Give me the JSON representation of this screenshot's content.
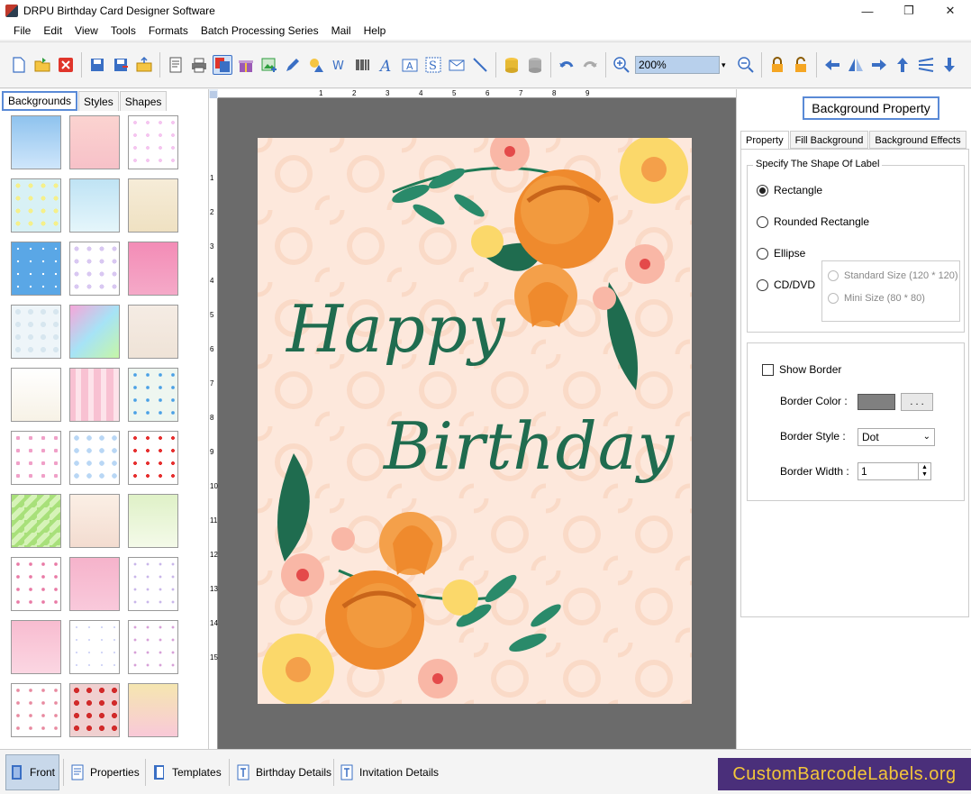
{
  "window": {
    "title": "DRPU Birthday Card Designer Software",
    "min_glyph": "—",
    "max_glyph": "❐",
    "close_glyph": "✕"
  },
  "menu": [
    "File",
    "Edit",
    "View",
    "Tools",
    "Formats",
    "Batch Processing Series",
    "Mail",
    "Help"
  ],
  "toolbar": {
    "zoom_value": "200%",
    "zoom_drop": "▾"
  },
  "left_panel": {
    "tabs": [
      "Backgrounds",
      "Styles",
      "Shapes"
    ]
  },
  "ruler": {
    "h_ticks": [
      "1",
      "2",
      "3",
      "4",
      "5",
      "6",
      "7",
      "8",
      "9"
    ],
    "v_ticks": [
      "1",
      "2",
      "3",
      "4",
      "5",
      "6",
      "7",
      "8",
      "9",
      "10",
      "11",
      "12",
      "13",
      "14",
      "15"
    ]
  },
  "card": {
    "line1": "Happy",
    "line2": "Birthday"
  },
  "right_panel": {
    "header": "Background Property",
    "tabs": [
      "Property",
      "Fill Background",
      "Background Effects"
    ],
    "shape_group_label": "Specify The Shape Of Label",
    "shapes": [
      "Rectangle",
      "Rounded Rectangle",
      "Ellipse",
      "CD/DVD"
    ],
    "selected_shape": "Rectangle",
    "cd_options": [
      "Standard Size (120 * 120)",
      "Mini Size (80 * 80)"
    ],
    "show_border": "Show Border",
    "border_color_label": "Border Color :",
    "border_color_btn": ". . .",
    "border_style_label": "Border Style :",
    "border_style_value": "Dot",
    "border_width_label": "Border Width :",
    "border_width_value": "1"
  },
  "bottom_tabs": [
    "Front",
    "Properties",
    "Templates",
    "Birthday Details",
    "Invitation Details"
  ],
  "brand": "CustomBarcodeLabels.org",
  "colors": {
    "accent": "#5a8ad6",
    "card_text": "#1f6c4f",
    "brand_bg": "#4a2f7a",
    "brand_fg": "#f3c63a"
  }
}
